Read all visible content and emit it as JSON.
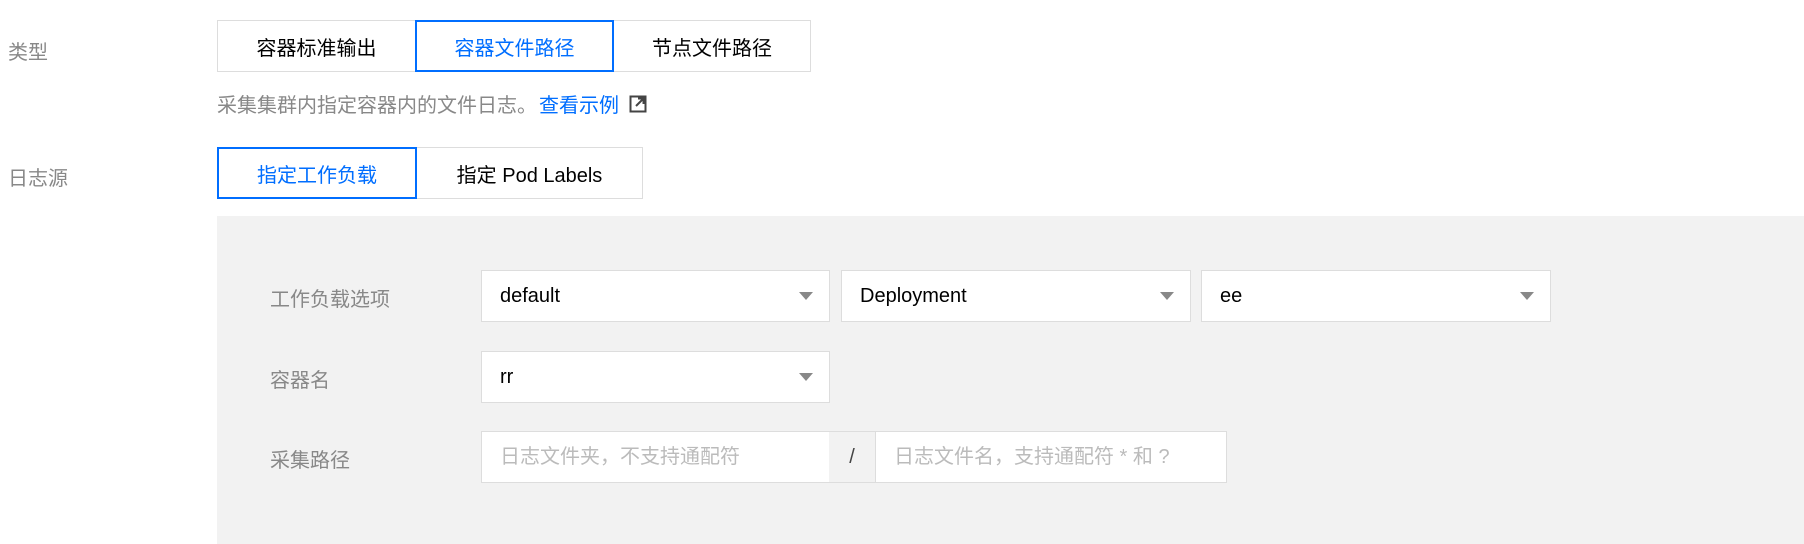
{
  "type_row": {
    "label": "类型",
    "options": [
      "容器标准输出",
      "容器文件路径",
      "节点文件路径"
    ],
    "selected": "容器文件路径",
    "description": "采集集群内指定容器内的文件日志。",
    "example_link": "查看示例",
    "example_link_icon": "external-link-icon"
  },
  "source_row": {
    "label": "日志源",
    "options": [
      "指定工作负载",
      "指定 Pod Labels"
    ],
    "selected": "指定工作负载"
  },
  "workload": {
    "label": "工作负载选项",
    "namespace_value": "default",
    "kind_value": "Deployment",
    "name_value": "ee"
  },
  "container": {
    "label": "容器名",
    "value": "rr"
  },
  "path": {
    "label": "采集路径",
    "folder_placeholder": "日志文件夹，不支持通配符",
    "separator": "/",
    "file_placeholder": "日志文件名，支持通配符 * 和 ?"
  },
  "colors": {
    "accent": "#006eff",
    "label_gray": "#888888",
    "panel_bg": "#f2f2f2",
    "border": "#dddddd"
  }
}
